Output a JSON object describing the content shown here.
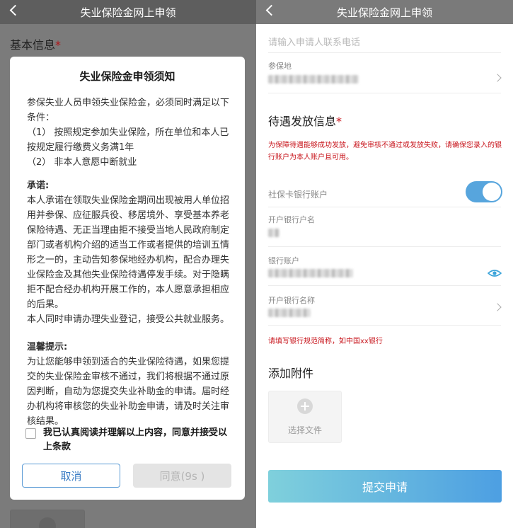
{
  "left": {
    "nav_title": "失业保险金网上申领",
    "page_section_title": "基本信息",
    "required_mark": "*",
    "dialog": {
      "title": "失业保险金申领须知",
      "intro": "参保失业人员申领失业保险金，必须同时满足以下条件：",
      "conditions": [
        "（1） 按照规定参加失业保险，所在单位和本人已按规定履行缴费义务满1年",
        "（2） 非本人意愿中断就业"
      ],
      "promise_heading": "承诺:",
      "promise_text": "本人承诺在领取失业保险金期间出现被用人单位招用并参保、应征服兵役、移居境外、享受基本养老保险待遇、无正当理由拒不接受当地人民政府制定部门或者机构介绍的适当工作或者提供的培训五情形之一的，主动告知参保地经办机构，配合办理失业保险金及其他失业保险待遇停发手续。对于隐瞒拒不配合经办机构开展工作的，本人愿意承担相应的后果。",
      "promise_text_2": "本人同时申请办理失业登记，接受公共就业服务。",
      "tips_heading": "温馨提示:",
      "tips_text": "为让您能够申领到适合的失业保险待遇，如果您提交的失业保险金审核不通过，我们将根据不通过原因判断，自动为您提交失业补助金的申请。届时经办机构将审核您的失业补助金申请，请及时关注审核结果。",
      "agree_text": "我已认真阅读并理解以上内容，同意并接受以上条款",
      "cancel_label": "取消",
      "confirm_label": "同意(9s )"
    }
  },
  "right": {
    "nav_title": "失业保险金网上申领",
    "phone_placeholder": "请输入申请人联系电话",
    "insured_place_label": "参保地",
    "benefit_section_title": "待遇发放信息",
    "required_mark": "*",
    "benefit_notice": "为保障待遇能够成功发放，避免审核不通过或发放失败，请确保您录入的银行账户为本人账户且可用。",
    "social_card_label": "社保卡银行账户",
    "social_card_toggle_on": true,
    "account_name_label": "开户银行户名",
    "account_number_label": "银行账户",
    "bank_name_label": "开户银行名称",
    "bank_notice": "请填写银行规范简称，如中国xx银行",
    "attachment_title": "添加附件",
    "upload_label": "选择文件",
    "submit_label": "提交申请"
  },
  "colors": {
    "accent_blue": "#4d9fe2",
    "warning_red": "#c8161d",
    "toggle_blue": "#57a5dd"
  },
  "icons": [
    "back-icon",
    "chevron-right-icon",
    "eye-icon",
    "plus-icon",
    "checkbox-icon"
  ]
}
